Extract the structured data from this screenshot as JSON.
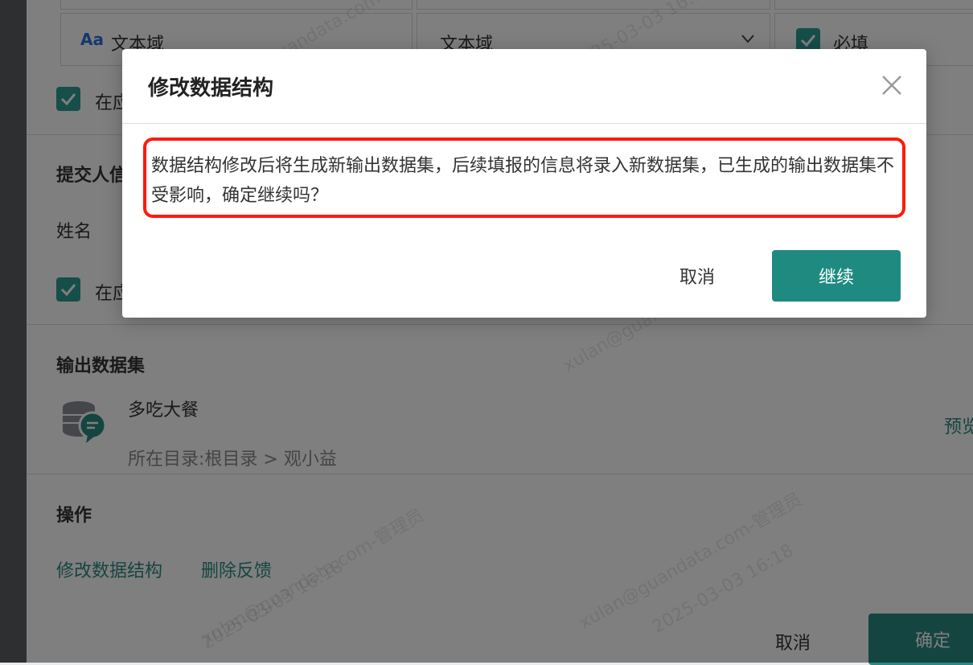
{
  "background_form": {
    "field_row": {
      "field_type_icon": "Aa",
      "field_type_label": "文本域",
      "select_value": "文本域",
      "required_label": "必填"
    },
    "checkbox1_label": "在应",
    "submitter_section_title": "提交人信",
    "name_label": "姓名",
    "checkbox2_label": "在应",
    "output_dataset": {
      "title": "输出数据集",
      "dataset_name": "多吃大餐",
      "directory": "所在目录:根目录 > 观小益",
      "preview_link": "预览"
    },
    "operations": {
      "title": "操作",
      "modify_link": "修改数据结构",
      "delete_link": "删除反馈"
    },
    "footer": {
      "cancel_label": "取消",
      "confirm_label": "确定"
    },
    "watermark_user": "xulan@guandata.com-管理员",
    "watermark_time": "2025-03-03 16:18"
  },
  "modal": {
    "title": "修改数据结构",
    "message": "数据结构修改后将生成新输出数据集，后续填报的信息将录入新数据集，已生成的输出数据集不受影响，确定继续吗？",
    "cancel_label": "取消",
    "continue_label": "继续"
  },
  "colors": {
    "accent": "#1f8a80",
    "highlight_border": "#ff1a0f",
    "checkbox": "#2d9d94"
  }
}
